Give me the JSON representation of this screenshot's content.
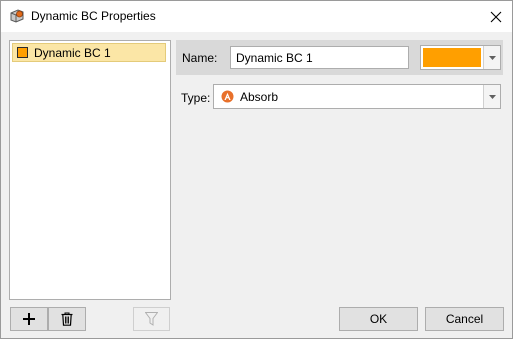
{
  "window": {
    "title": "Dynamic BC Properties",
    "icon": "dynamic-bc-icon",
    "close_icon": "close-icon"
  },
  "list": {
    "items": [
      {
        "label": "Dynamic BC 1",
        "color": "#ff9f00",
        "selected": true
      }
    ],
    "add_icon": "plus-icon",
    "delete_icon": "trash-icon",
    "filter_icon": "filter-icon"
  },
  "properties": {
    "name_label": "Name:",
    "name_value": "Dynamic BC 1",
    "color": "#ff9f00",
    "type_label": "Type:",
    "type_value": "Absorb",
    "type_icon": "absorb-icon"
  },
  "buttons": {
    "ok": "OK",
    "cancel": "Cancel"
  }
}
